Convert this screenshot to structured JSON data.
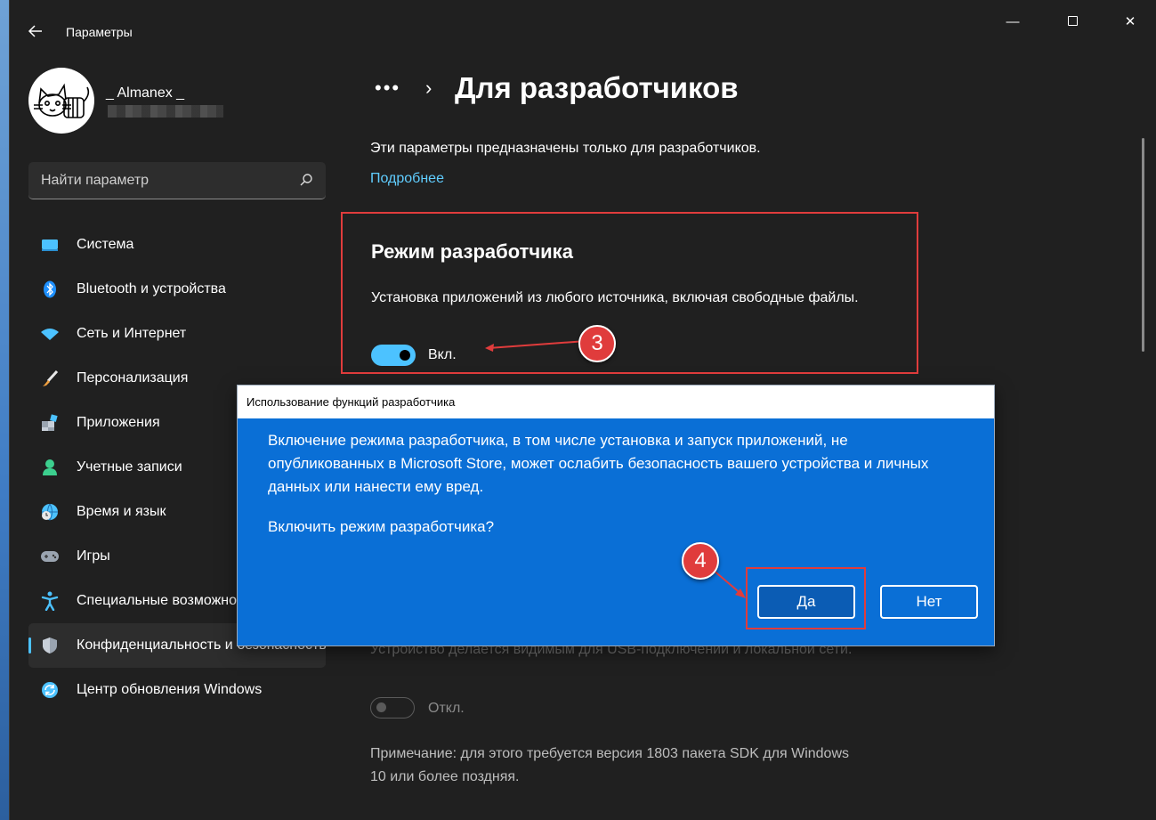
{
  "window": {
    "title": "Параметры",
    "controls": {
      "minimize": "—",
      "close": "✕"
    }
  },
  "profile": {
    "name": "_ Almanex _"
  },
  "search": {
    "placeholder": "Найти параметр"
  },
  "sidebar": {
    "items": [
      {
        "label": "Система",
        "icon": "system-icon",
        "color": "#4cc2ff"
      },
      {
        "label": "Bluetooth и устройства",
        "icon": "bluetooth-icon",
        "color": "#1e90ff"
      },
      {
        "label": "Сеть и Интернет",
        "icon": "wifi-icon",
        "color": "#4cc2ff"
      },
      {
        "label": "Персонализация",
        "icon": "brush-icon",
        "color": "#f0a040"
      },
      {
        "label": "Приложения",
        "icon": "apps-icon",
        "color": "#9aa4b0"
      },
      {
        "label": "Учетные записи",
        "icon": "account-icon",
        "color": "#3ccf8e"
      },
      {
        "label": "Время и язык",
        "icon": "globe-clock-icon",
        "color": "#4cc2ff"
      },
      {
        "label": "Игры",
        "icon": "gamepad-icon",
        "color": "#9aa4b0"
      },
      {
        "label": "Специальные возможности",
        "icon": "accessibility-icon",
        "color": "#4cc2ff"
      },
      {
        "label": "Конфиденциальность и безопасность",
        "icon": "shield-icon",
        "color": "#9aa4b0"
      },
      {
        "label": "Центр обновления Windows",
        "icon": "update-icon",
        "color": "#4cc2ff"
      }
    ],
    "active_index": 9
  },
  "breadcrumb": {
    "dots": "•••",
    "chevron": "›"
  },
  "main": {
    "title": "Для разработчиков",
    "description": "Эти параметры предназначены только для разработчиков.",
    "more_link": "Подробнее",
    "dev_mode": {
      "title": "Режим разработчика",
      "description": "Установка приложений из любого источника, включая свободные файлы.",
      "state": "Вкл."
    },
    "device_discovery": {
      "description": "Устройство делается видимым для USB-подключений и локальной сети.",
      "state": "Откл."
    },
    "note": "Примечание: для этого требуется версия 1803 пакета SDK для Windows 10 или более поздняя."
  },
  "dialog": {
    "title": "Использование функций разработчика",
    "body": "Включение режима разработчика, в том числе установка и запуск приложений, не опубликованных в Microsoft Store, может ослабить безопасность вашего устройства и личных данных или нанести ему вред.",
    "question": "Включить режим разработчика?",
    "yes_label": "Да",
    "no_label": "Нет"
  },
  "annotations": {
    "step3": "3",
    "step4": "4",
    "color": "#e03c3c"
  }
}
